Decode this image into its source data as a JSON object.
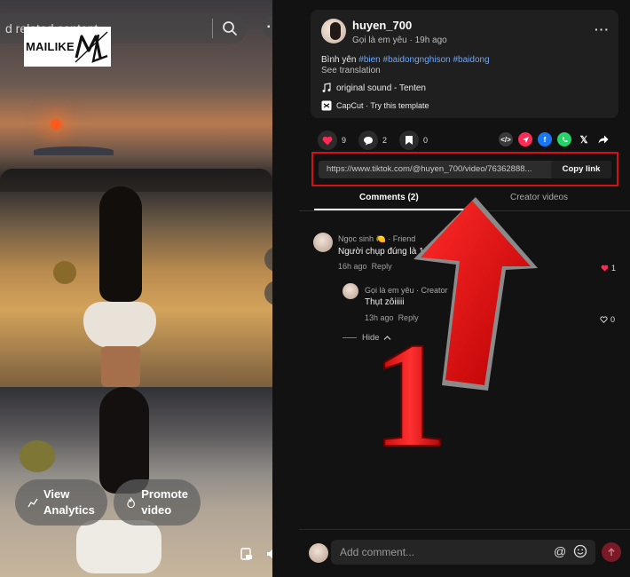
{
  "video": {
    "search_placeholder": "d related content",
    "logo_text": "MAILIKE",
    "analytics_label_1": "View",
    "analytics_label_2": "Analytics",
    "promote_label_1": "Promote",
    "promote_label_2": "video"
  },
  "post": {
    "username": "huyen_700",
    "nickname": "Gọi là em yêu",
    "time": "19h ago",
    "subline_sep": " · ",
    "caption_text": "Bình yên ",
    "hashtags": [
      "#bien",
      "#baidongnghison",
      "#baidong"
    ],
    "see_translation": "See translation",
    "sound": "original sound - Tenten",
    "capcut": "CapCut · Try this template"
  },
  "actions": {
    "likes": "9",
    "comments": "2",
    "saves": "0",
    "colors": {
      "like": "#fe2c55",
      "whatsapp": "#25d366",
      "facebook": "#1877f2",
      "pink": "#fe2c55"
    }
  },
  "share_link": {
    "url": "https://www.tiktok.com/@huyen_700/video/76362888...",
    "copy_label": "Copy link"
  },
  "tabs": {
    "comments": "Comments (2)",
    "creator": "Creator videos"
  },
  "comments": [
    {
      "name": "Ngọc sinh",
      "emoji": "🍋",
      "tag": "· Friend",
      "text": "Người chụp đúng là 1 n",
      "time": "16h ago",
      "reply": "Reply",
      "likes": "1"
    },
    {
      "name": "Gọi là em yêu",
      "tag": "· Creator",
      "text": "Thụt zôiiiii",
      "time": "13h ago",
      "reply": "Reply",
      "likes": "0"
    }
  ],
  "hide_label": "Hide",
  "annotation_number": "1",
  "composer": {
    "placeholder": "Add comment..."
  }
}
